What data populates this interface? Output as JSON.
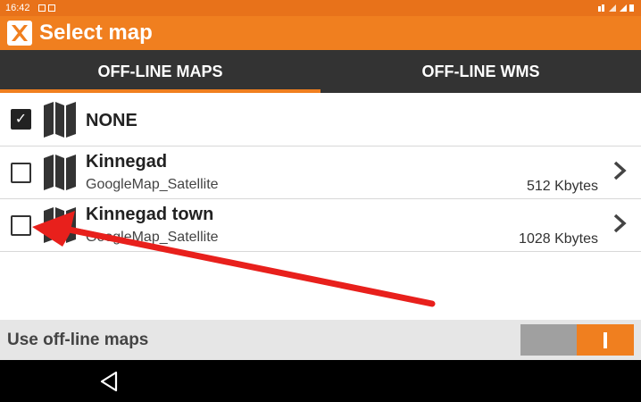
{
  "status": {
    "time": "16:42"
  },
  "app": {
    "title": "Select map",
    "logo": "app-logo-icon"
  },
  "tabs": [
    {
      "label": "OFF-LINE MAPS",
      "active": true
    },
    {
      "label": "OFF-LINE WMS",
      "active": false
    }
  ],
  "list": {
    "none": {
      "label": "NONE",
      "checked": true
    },
    "items": [
      {
        "title": "Kinnegad",
        "subtitle": "GoogleMap_Satellite",
        "size": "512 Kbytes",
        "checked": false
      },
      {
        "title": "Kinnegad town",
        "subtitle": "GoogleMap_Satellite",
        "size": "1028 Kbytes",
        "checked": false
      }
    ]
  },
  "footer": {
    "label": "Use off-line maps",
    "toggle_on": true
  },
  "colors": {
    "accent": "#f07f1f",
    "tabbar": "#333333",
    "annotation_arrow": "#e8201c"
  }
}
